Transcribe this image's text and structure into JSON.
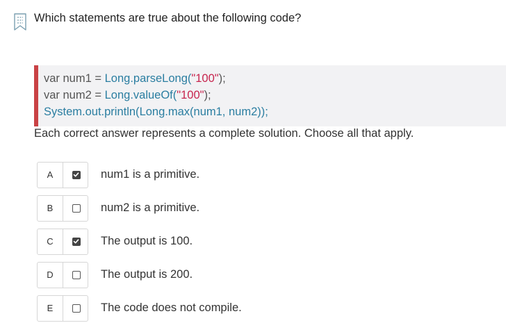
{
  "question": "Which statements are true about the following code?",
  "code": {
    "line1": {
      "a": "var num1 = ",
      "b": "Long",
      "c": ".parseLong(",
      "d": "\"100\"",
      "e": ");"
    },
    "line2": {
      "a": "var num2 = ",
      "b": "Long",
      "c": ".valueOf(",
      "d": "\"100\"",
      "e": ");"
    },
    "line3": {
      "a": "System",
      "b": ".out.println(",
      "c": "Long",
      "d": ".max(num1, num2));"
    }
  },
  "instruction": "Each correct answer represents a complete solution. Choose all that apply.",
  "options": [
    {
      "letter": "A",
      "label": "num1 is a primitive.",
      "checked": true
    },
    {
      "letter": "B",
      "label": "num2 is a primitive.",
      "checked": false
    },
    {
      "letter": "C",
      "label": "The output is 100.",
      "checked": true
    },
    {
      "letter": "D",
      "label": "The output is 200.",
      "checked": false
    },
    {
      "letter": "E",
      "label": "The code does not compile.",
      "checked": false
    }
  ],
  "colors": {
    "accent_border": "#c94245",
    "code_background": "#f2f2f4",
    "type_token": "#2b7ea1",
    "string_token": "#c7254e"
  },
  "icons": {
    "bookmark": "bookmark-icon",
    "checkbox": "checkbox-icon"
  }
}
